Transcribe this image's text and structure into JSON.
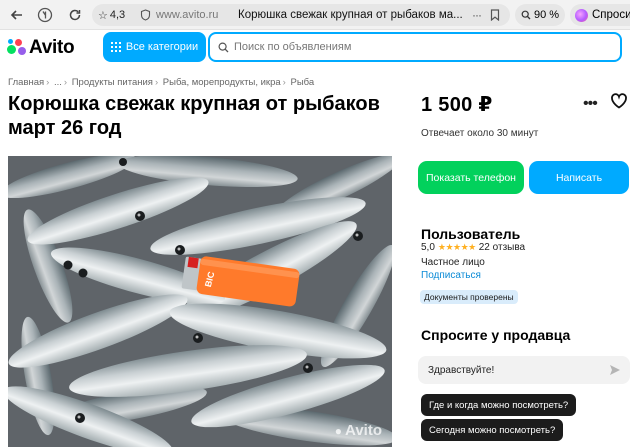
{
  "browser": {
    "site_rating": "4,3",
    "domain": "www.avito.ru",
    "tab_title": "Корюшка свежак крупная от рыбаков ма...",
    "zoom": "90 %",
    "ask_label": "Спроси"
  },
  "header": {
    "logo_text": "Avito",
    "categories_label": "Все категории",
    "search_placeholder": "Поиск по объявлениям"
  },
  "breadcrumb": [
    "Главная",
    "...",
    "Продукты питания",
    "Рыба, морепродукты, икра",
    "Рыба"
  ],
  "listing": {
    "title": "Корюшка свежак крупная от рыбаков март 26 год",
    "price": "1 500 ₽",
    "reply_time": "Отвечает около 30 минут",
    "photo_watermark": "Avito",
    "lighter_text": "BIC"
  },
  "actions": {
    "show_phone": "Показать телефон",
    "write": "Написать"
  },
  "seller": {
    "name": "Пользователь",
    "rating": "5,0",
    "stars": "★★★★★",
    "reviews": "22 отзыва",
    "type": "Частное лицо",
    "subscribe": "Подписаться",
    "verified": "Документы проверены"
  },
  "ask_seller": {
    "title": "Спросите у продавца",
    "message_value": "Здравствуйте!",
    "quick_questions": [
      "Где и когда можно посмотреть?",
      "Сегодня можно посмотреть?"
    ]
  },
  "colors": {
    "brand_blue": "#00aaff",
    "phone_green": "#02d15c",
    "star_gold": "#ffb021"
  }
}
